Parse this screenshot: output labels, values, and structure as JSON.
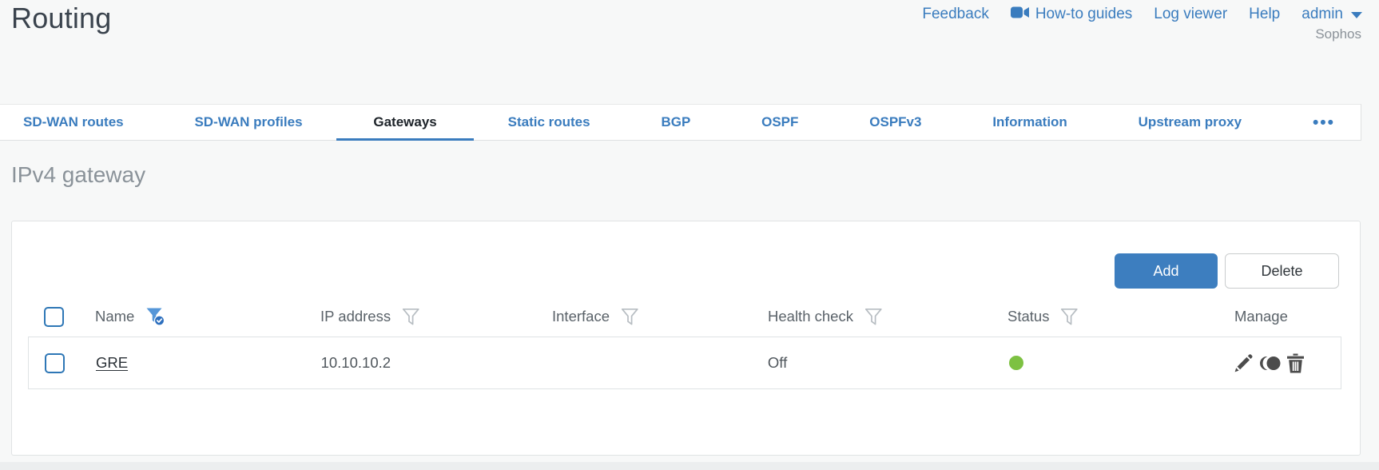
{
  "page": {
    "title": "Routing",
    "brand": "Sophos"
  },
  "header": {
    "links": [
      {
        "label": "Feedback"
      },
      {
        "label": "How-to guides",
        "icon": "video-camera-icon"
      },
      {
        "label": "Log viewer"
      },
      {
        "label": "Help"
      },
      {
        "label": "admin",
        "icon": "chevron-down-icon"
      }
    ]
  },
  "tabs": [
    {
      "label": "SD-WAN routes",
      "active": false
    },
    {
      "label": "SD-WAN profiles",
      "active": false
    },
    {
      "label": "Gateways",
      "active": true
    },
    {
      "label": "Static routes",
      "active": false
    },
    {
      "label": "BGP",
      "active": false
    },
    {
      "label": "OSPF",
      "active": false
    },
    {
      "label": "OSPFv3",
      "active": false
    },
    {
      "label": "Information",
      "active": false
    },
    {
      "label": "Upstream proxy",
      "active": false
    },
    {
      "label": "•••",
      "active": false,
      "name": "more-tabs"
    }
  ],
  "section": {
    "title": "IPv4 gateway"
  },
  "toolbar": {
    "add_label": "Add",
    "delete_label": "Delete"
  },
  "table": {
    "columns": [
      {
        "label": "Name",
        "filter": "active"
      },
      {
        "label": "IP address",
        "filter": "inactive"
      },
      {
        "label": "Interface",
        "filter": "inactive"
      },
      {
        "label": "Health check",
        "filter": "inactive"
      },
      {
        "label": "Status",
        "filter": "inactive"
      },
      {
        "label": "Manage",
        "filter": "none"
      }
    ],
    "rows": [
      {
        "name": "GRE",
        "ip_address": "10.10.10.2",
        "interface": "",
        "health_check": "Off",
        "status": "up",
        "status_color": "#7dc142",
        "actions": [
          "edit",
          "clone",
          "delete"
        ]
      }
    ]
  },
  "colors": {
    "accent_blue": "#3a7cbe",
    "button_blue": "#3d7ebf",
    "status_green": "#7dc142",
    "active_filter_blue": "#5596d8"
  }
}
